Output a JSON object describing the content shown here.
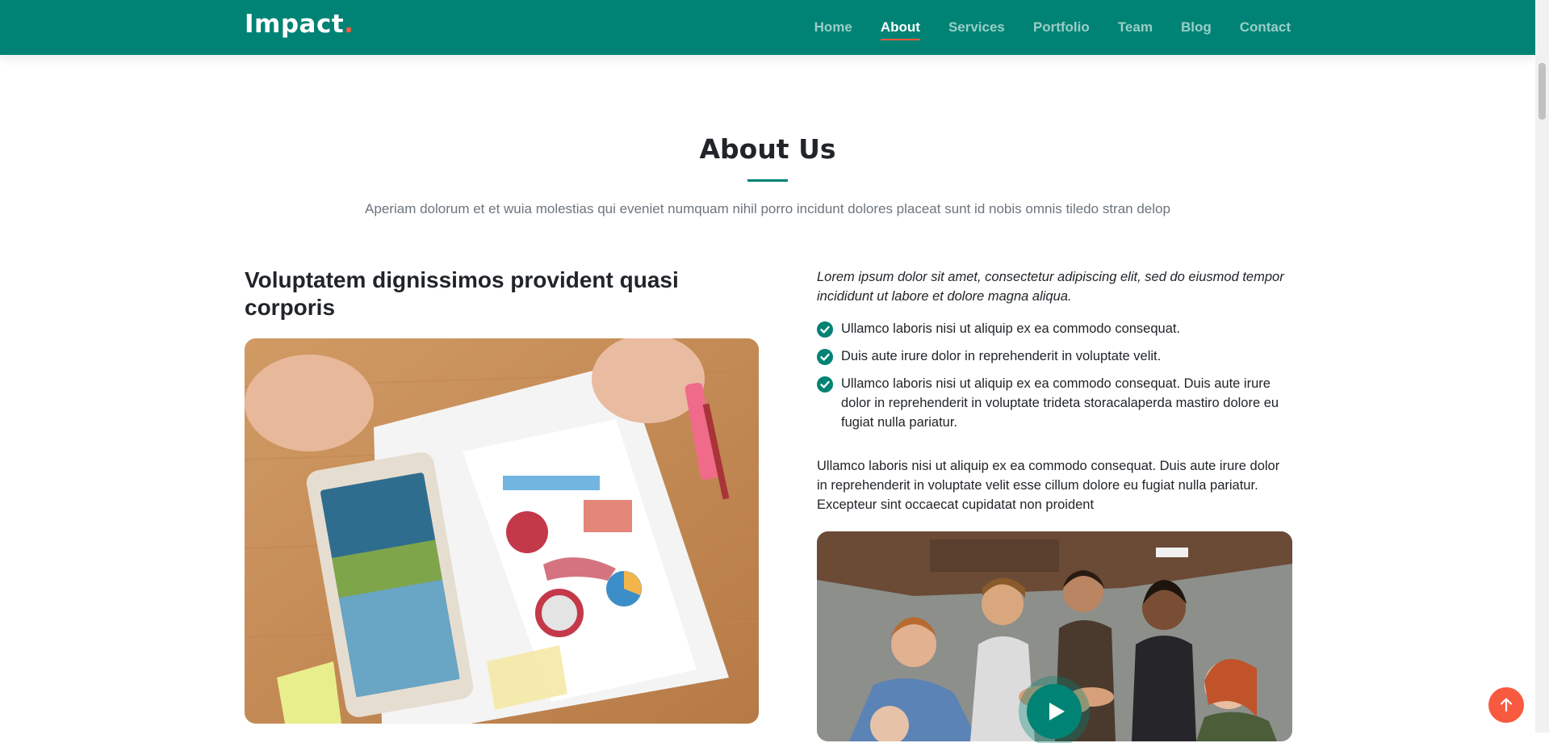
{
  "header": {
    "logo_text": "Impact",
    "logo_dot": ".",
    "nav": [
      "Home",
      "About",
      "Services",
      "Portfolio",
      "Team",
      "Blog",
      "Contact"
    ],
    "active": "About"
  },
  "about": {
    "title": "About Us",
    "subtitle": "Aperiam dolorum et et wuia molestias qui eveniet numquam nihil porro incidunt dolores placeat sunt id nobis omnis tiledo stran delop",
    "left_heading": "Voluptatem dignissimos provident quasi corporis",
    "intro": "Lorem ipsum dolor sit amet, consectetur adipiscing elit, sed do eiusmod tempor incididunt ut labore et dolore magna aliqua.",
    "checklist": [
      "Ullamco laboris nisi ut aliquip ex ea commodo consequat.",
      "Duis aute irure dolor in reprehenderit in voluptate velit.",
      "Ullamco laboris nisi ut aliquip ex ea commodo consequat. Duis aute irure dolor in reprehenderit in voluptate trideta storacalaperda mastiro dolore eu fugiat nulla pariatur."
    ],
    "paragraph": "Ullamco laboris nisi ut aliquip ex ea commodo consequat. Duis aute irure dolor in reprehenderit in voluptate velit esse cillum dolore eu fugiat nulla pariatur. Excepteur sint occaecat cupidatat non proident"
  },
  "icons": {
    "check": "check-circle-icon",
    "play": "play-icon",
    "back_to_top": "arrow-up-icon"
  },
  "colors": {
    "brand": "#008374",
    "accent": "#f85a40"
  }
}
